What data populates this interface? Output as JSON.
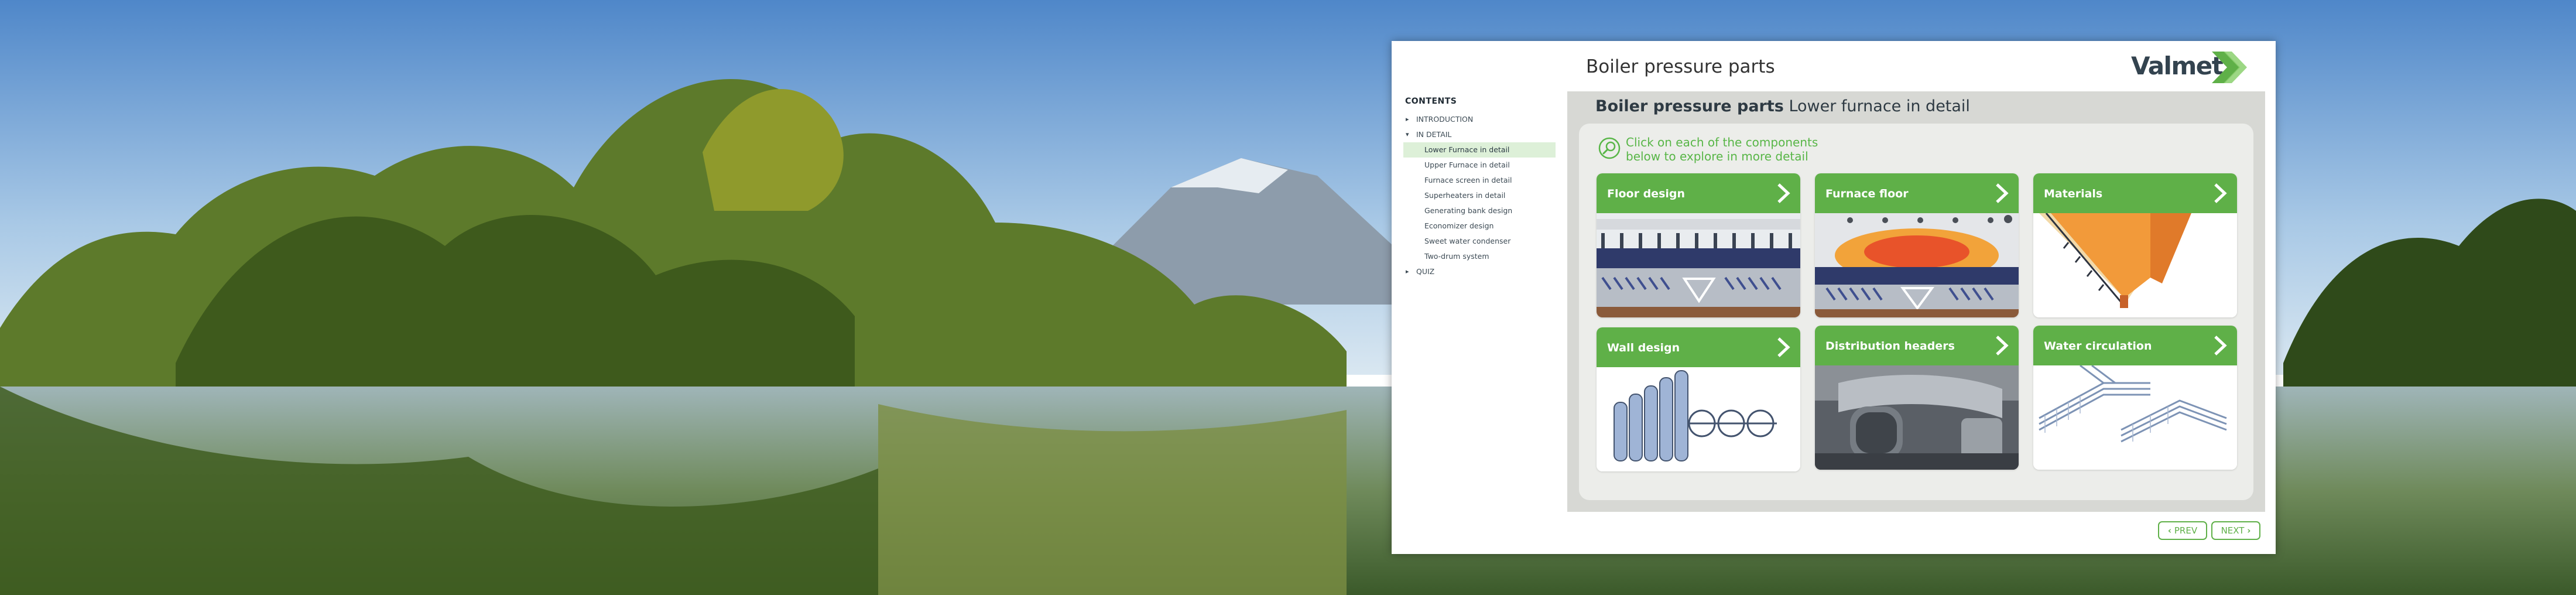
{
  "header": {
    "title": "Boiler pressure parts"
  },
  "logo": {
    "text": "Valmet"
  },
  "sidebar": {
    "heading": "CONTENTS",
    "items": [
      {
        "label": "INTRODUCTION",
        "level": 0
      },
      {
        "label": "IN DETAIL",
        "level": 0
      },
      {
        "label": "Lower Furnace in detail",
        "level": 1,
        "active": true
      },
      {
        "label": "Upper Furnace in detail",
        "level": 1
      },
      {
        "label": "Furnace screen in detail",
        "level": 1
      },
      {
        "label": "Superheaters in detail",
        "level": 1
      },
      {
        "label": "Generating bank design",
        "level": 1
      },
      {
        "label": "Economizer design",
        "level": 1
      },
      {
        "label": "Sweet water condenser",
        "level": 1
      },
      {
        "label": "Two-drum system",
        "level": 1
      },
      {
        "label": "QUIZ",
        "level": 0
      }
    ]
  },
  "main": {
    "title_bold": "Boiler pressure parts",
    "title_rest": "Lower furnace in detail",
    "hint_line1": "Click on each of the components",
    "hint_line2": "below to explore in more detail",
    "cards": [
      {
        "label": "Floor design"
      },
      {
        "label": "Furnace floor"
      },
      {
        "label": "Materials"
      },
      {
        "label": "Wall design"
      },
      {
        "label": "Distribution headers"
      },
      {
        "label": "Water circulation"
      }
    ]
  },
  "footer": {
    "prev_label": "PREV",
    "next_label": "NEXT"
  },
  "colors": {
    "accent": "#5fb048",
    "hint": "#58b647",
    "active_nav": "#ddf0d8",
    "panel": "#ecedea"
  }
}
